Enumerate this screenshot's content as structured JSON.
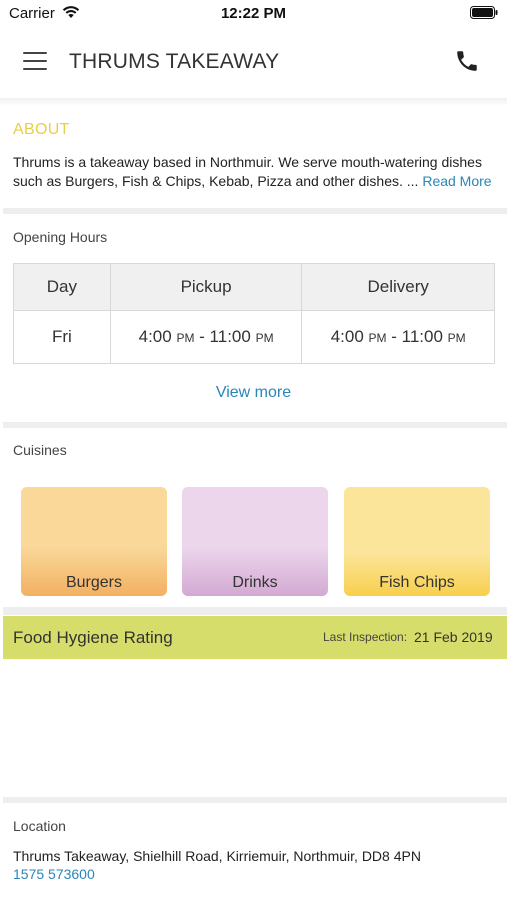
{
  "status_bar": {
    "carrier": "Carrier",
    "time": "12:22 PM"
  },
  "header": {
    "title": "THRUMS TAKEAWAY"
  },
  "about": {
    "heading": "ABOUT",
    "text": "Thrums is a takeaway based in Northmuir. We serve mouth-watering dishes such as Burgers, Fish & Chips, Kebab, Pizza and other dishes.",
    "ellipsis": "...",
    "read_more": "Read More"
  },
  "opening_hours": {
    "label": "Opening Hours",
    "columns": [
      "Day",
      "Pickup",
      "Delivery"
    ],
    "rows": [
      {
        "day": "Fri",
        "pickup_open": "4:00",
        "pickup_open_ampm": "PM",
        "pickup_close": "11:00",
        "pickup_close_ampm": "PM",
        "delivery_open": "4:00",
        "delivery_open_ampm": "PM",
        "delivery_close": "11:00",
        "delivery_close_ampm": "PM"
      }
    ],
    "view_more": "View more"
  },
  "cuisines": {
    "label": "Cuisines",
    "items": [
      {
        "name": "Burgers",
        "color": "#f3b061"
      },
      {
        "name": "Drinks",
        "color": "#d3a9d3"
      },
      {
        "name": "Fish  Chips",
        "color": "#f8cf4d"
      }
    ]
  },
  "food_hygiene": {
    "title": "Food Hygiene Rating",
    "inspection_label": "Last Inspection:",
    "inspection_date": "21 Feb 2019",
    "color": "#d7dd6a"
  },
  "location": {
    "label": "Location",
    "address": "Thrums Takeaway, Shielhill Road, Kirriemuir, Northmuir, DD8 4PN",
    "phone": "1575 573600"
  },
  "colors": {
    "accent": "#2a86b8",
    "about_heading": "#e7cf4a"
  }
}
